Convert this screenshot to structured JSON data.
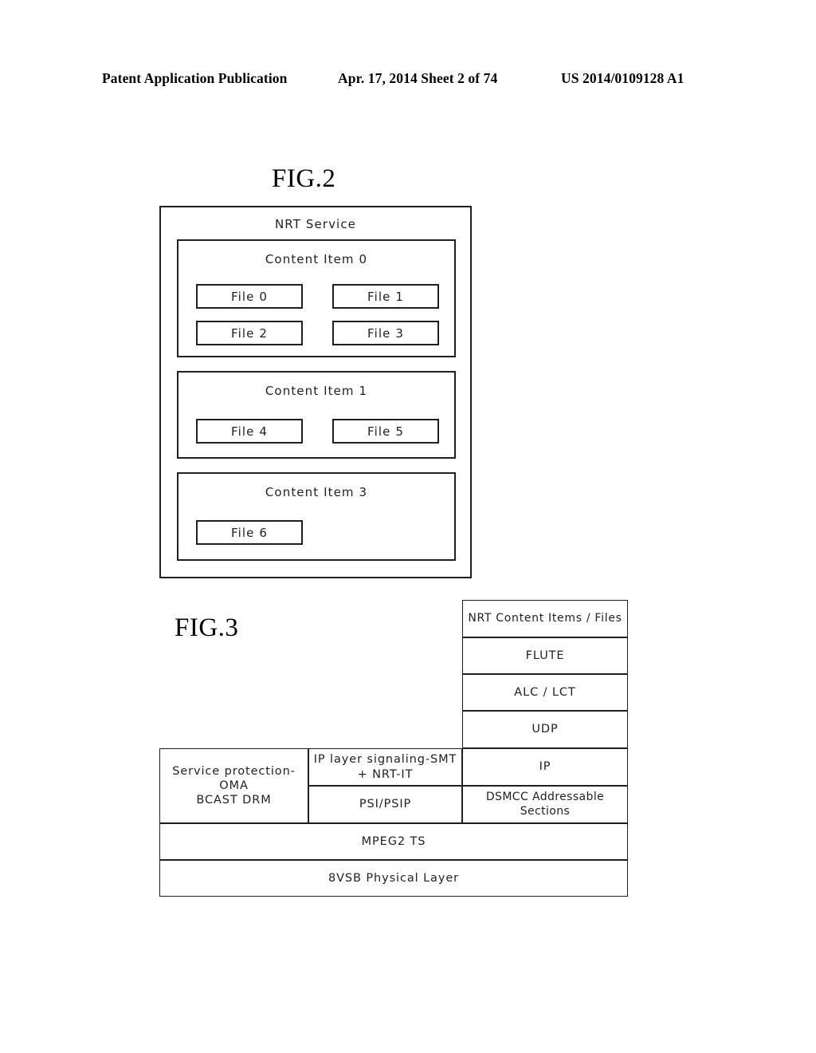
{
  "header": {
    "publication": "Patent Application Publication",
    "date_sheet": "Apr. 17, 2014  Sheet 2 of 74",
    "patent_number": "US 2014/0109128 A1"
  },
  "fig2": {
    "caption": "FIG.2",
    "service_title": "NRT Service",
    "content_items": [
      {
        "title": "Content Item 0",
        "files": [
          "File 0",
          "File 1",
          "File 2",
          "File 3"
        ]
      },
      {
        "title": "Content Item 1",
        "files": [
          "File 4",
          "File 5"
        ]
      },
      {
        "title": "Content Item 3",
        "files": [
          "File 6"
        ]
      }
    ]
  },
  "fig3": {
    "caption": "FIG.3",
    "stack": {
      "nrt_content_items": "NRT Content Items / Files",
      "flute": "FLUTE",
      "alc_lct": "ALC / LCT",
      "udp": "UDP",
      "ip": "IP",
      "dsmcc": "DSMCC Addressable Sections",
      "ip_layer_signaling": "IP layer signaling-SMT\n+ NRT-IT",
      "psi_psip": "PSI/PSIP",
      "service_protection": "Service protection-OMA\nBCAST DRM",
      "mpeg2_ts": "MPEG2 TS",
      "physical_layer": "8VSB Physical Layer"
    }
  },
  "colors": {
    "ink": "#231f20",
    "paper": "#ffffff"
  }
}
